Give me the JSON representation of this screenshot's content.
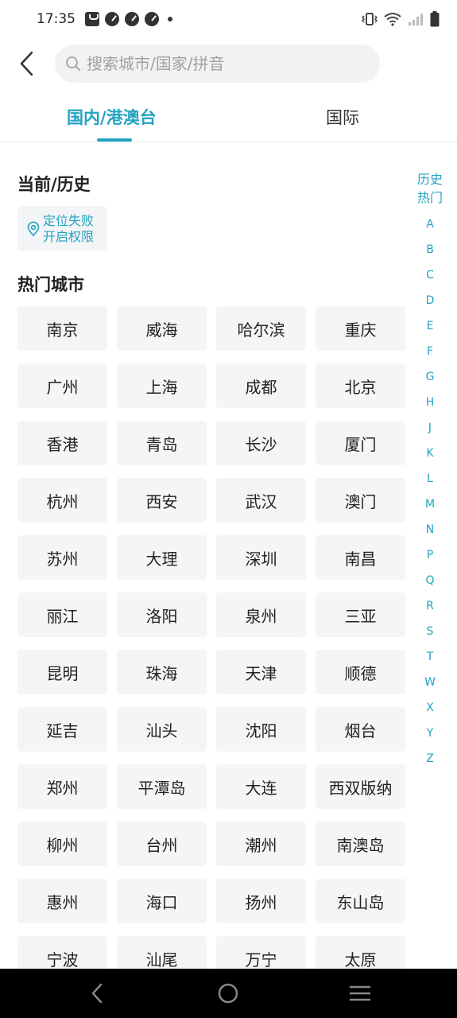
{
  "status_bar": {
    "time": "17:35"
  },
  "search": {
    "placeholder": "搜索城市/国家/拼音"
  },
  "tabs": [
    {
      "label": "国内/港澳台",
      "active": true
    },
    {
      "label": "国际",
      "active": false
    }
  ],
  "history": {
    "title": "当前/历史",
    "locate_line1": "定位失败",
    "locate_line2": "开启权限"
  },
  "hot": {
    "title": "热门城市",
    "cities": [
      "南京",
      "威海",
      "哈尔滨",
      "重庆",
      "广州",
      "上海",
      "成都",
      "北京",
      "香港",
      "青岛",
      "长沙",
      "厦门",
      "杭州",
      "西安",
      "武汉",
      "澳门",
      "苏州",
      "大理",
      "深圳",
      "南昌",
      "丽江",
      "洛阳",
      "泉州",
      "三亚",
      "昆明",
      "珠海",
      "天津",
      "顺德",
      "延吉",
      "汕头",
      "沈阳",
      "烟台",
      "郑州",
      "平潭岛",
      "大连",
      "西双版纳",
      "柳州",
      "台州",
      "潮州",
      "南澳岛",
      "惠州",
      "海口",
      "扬州",
      "东山岛",
      "宁波",
      "汕尾",
      "万宁",
      "太原"
    ]
  },
  "index": {
    "history": "历史",
    "hot": "热门",
    "letters": [
      "A",
      "B",
      "C",
      "D",
      "E",
      "F",
      "G",
      "H",
      "J",
      "K",
      "L",
      "M",
      "N",
      "P",
      "Q",
      "R",
      "S",
      "T",
      "W",
      "X",
      "Y",
      "Z"
    ]
  },
  "colors": {
    "accent": "#23a3c1",
    "chip_bg": "#f5f5f5",
    "search_bg": "#f1f2f4"
  }
}
